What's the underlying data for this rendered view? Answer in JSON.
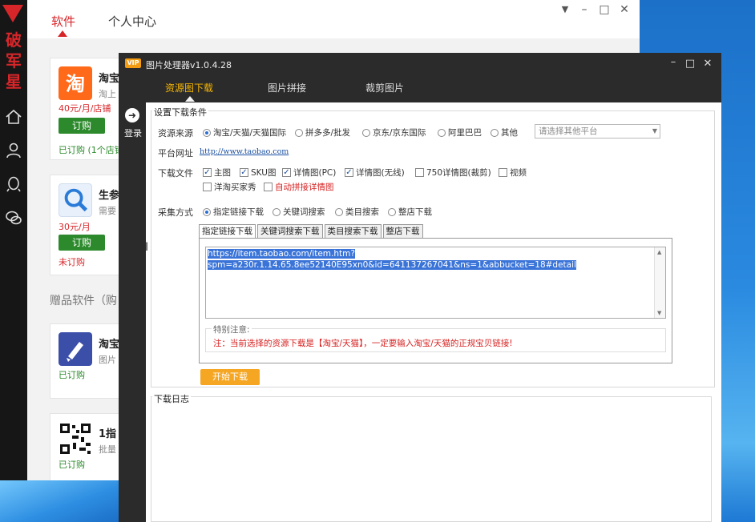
{
  "sidebar": {
    "brand_chars": [
      "破",
      "军",
      "星"
    ],
    "icons": [
      "home-icon",
      "user-icon",
      "qq-icon",
      "wechat-icon"
    ],
    "brand_color": "#d6262a"
  },
  "back_window": {
    "tabs": [
      {
        "label": "软件",
        "active": true
      },
      {
        "label": "个人中心",
        "active": false
      }
    ],
    "cards": [
      {
        "title": "淘宝",
        "sub": "淘上",
        "price": "40元/月/店铺",
        "button": "订购",
        "status": "已订购 (1个店铺"
      },
      {
        "title": "生参",
        "sub": "需要",
        "price": "30元/月",
        "button": "订购",
        "status": "未订购"
      },
      {
        "title": "淘宝",
        "sub": "图片",
        "status": "已订购"
      },
      {
        "title": "1指",
        "sub": "批量",
        "status": "已订购"
      }
    ],
    "gift_label": "赠品软件（购"
  },
  "front_window": {
    "badge": "VIP",
    "title": "图片处理器v1.0.4.28",
    "tabs": [
      {
        "label": "资源图下载",
        "active": true
      },
      {
        "label": "图片拼接",
        "active": false
      },
      {
        "label": "裁剪图片",
        "active": false
      }
    ],
    "login_label": "登录",
    "conditions_title": "设置下载条件",
    "source": {
      "label": "资源来源",
      "options": [
        "淘宝/天猫/天猫国际",
        "拼多多/批发",
        "京东/京东国际",
        "阿里巴巴",
        "其他"
      ],
      "selected": "淘宝/天猫/天猫国际",
      "other_placeholder": "请选择其他平台"
    },
    "platform": {
      "label": "平台网址",
      "url": "http://www.taobao.com"
    },
    "download_files": {
      "label": "下载文件",
      "options": [
        {
          "label": "主图",
          "checked": true
        },
        {
          "label": "SKU图",
          "checked": true
        },
        {
          "label": "详情图(PC)",
          "checked": true
        },
        {
          "label": "详情图(无线)",
          "checked": true
        },
        {
          "label": "750详情图(裁剪)",
          "checked": false
        },
        {
          "label": "视频",
          "checked": false
        },
        {
          "label": "洋淘买家秀",
          "checked": false
        },
        {
          "label": "自动拼接详情图",
          "checked": false
        }
      ]
    },
    "collect": {
      "label": "采集方式",
      "options": [
        "指定链接下载",
        "关键词搜索",
        "类目搜索",
        "整店下载"
      ],
      "selected": "指定链接下载"
    },
    "mode_tabs": [
      "指定链接下载",
      "关键词搜索下载",
      "类目搜索下载",
      "整店下载"
    ],
    "url_input_line1": "https://item.taobao.com/item.htm?",
    "url_input_line2": "spm=a230r.1.14.65.8ee52140E95xn0&id=641137267041&ns=1&abbucket=18#detail",
    "note_label": "特别注意:",
    "note_text": "注：当前选择的资源下载是【淘宝/天猫】，一定要输入淘宝/天猫的正规宝贝链接!",
    "start_button": "开始下载",
    "log_title": "下载日志",
    "accent_color": "#f5a623"
  }
}
